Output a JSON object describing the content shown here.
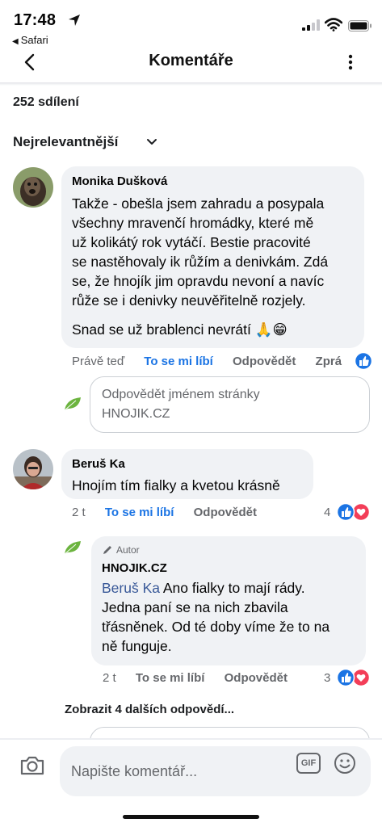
{
  "status": {
    "time": "17:48",
    "back_app": "Safari"
  },
  "nav": {
    "title": "Komentáře",
    "back_icon": "chevron-left-icon",
    "more_icon": "more-vertical-icon"
  },
  "shares_text": "252 sdílení",
  "sort_label": "Nejrelevantnější",
  "comments": [
    {
      "author": "Monika Dušková",
      "text_lines": [
        "Takže - obešla jsem zahradu a posypala",
        "všechny mravenčí hromádky, které mě",
        "už kolikátý rok vytáčí. Bestie pracovité",
        "se nastěhovaly ik růžím a denivkám. Zdá",
        "se, že hnojík jim opravdu nevoní a navíc",
        "růže se i denivky neuvěřitelně rozjely."
      ],
      "text_last": "Snad se už brablenci nevrátí 🙏😁",
      "time": "Právě teď",
      "like": "To se mi líbí",
      "reply": "Odpovědět",
      "more": "Zprá"
    },
    {
      "author": "Beruš Ka",
      "text": "Hnojím tím fialky a kvetou krásně",
      "time": "2 t",
      "like": "To se mi líbí",
      "reply": "Odpovědět",
      "reactions": "4"
    }
  ],
  "reply_as_page": {
    "line1": "Odpovědět jménem stránky",
    "line2": "HNOJIK.CZ"
  },
  "page_reply": {
    "badge": "Autor",
    "author": "HNOJIK.CZ",
    "tag": "Beruš Ka",
    "text_first": " Ano fialky to mají rády.",
    "text_lines": [
      "Jedna paní se na nich zbavila",
      "třásněnek. Od té doby víme že to na",
      "ně funguje."
    ],
    "time": "2 t",
    "like": "To se mi líbí",
    "reply": "Odpovědět",
    "reactions": "3"
  },
  "more_replies": "Zobrazit 4 dalších odpovědí...",
  "composer": {
    "placeholder": "Napište komentář...",
    "gif": "GIF"
  },
  "colors": {
    "accent": "#1b74e4",
    "bubble": "#f0f2f5",
    "secondary_text": "#65676b",
    "heart": "#f33e58"
  }
}
